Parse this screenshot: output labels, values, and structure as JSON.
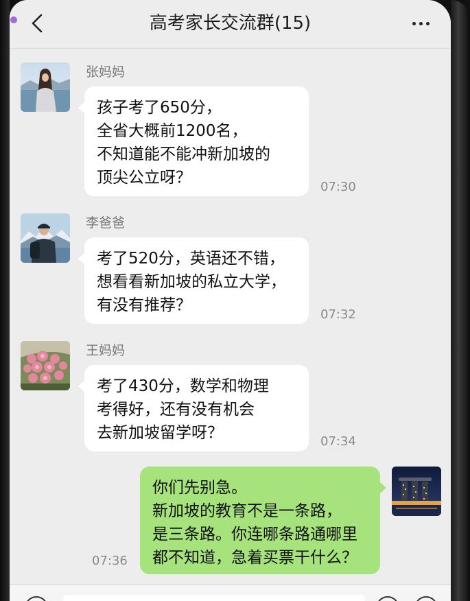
{
  "header": {
    "title": "高考家长交流群(15)",
    "back_icon": "chevron-left-icon",
    "more_icon": "more-horizontal-icon"
  },
  "messages": [
    {
      "sender": "张妈妈",
      "avatar": "woman-by-lake-avatar",
      "lines": [
        "孩子考了650分，",
        "全省大概前1200名，",
        "不知道能不能冲新加坡的",
        "顶尖公立呀？"
      ],
      "time": "07:30",
      "mine": false
    },
    {
      "sender": "李爸爸",
      "avatar": "man-mountain-avatar",
      "lines": [
        "考了520分，英语还不错，",
        "想看看新加坡的私立大学，",
        "有没有推荐？"
      ],
      "time": "07:32",
      "mine": false
    },
    {
      "sender": "王妈妈",
      "avatar": "pink-roses-avatar",
      "lines": [
        "考了430分，数学和物理",
        "考得好，还有没有机会",
        "去新加坡留学呀？"
      ],
      "time": "07:34",
      "mine": false
    },
    {
      "sender": "",
      "avatar": "singapore-night-skyline-avatar",
      "lines": [
        "你们先别急。",
        "新加坡的教育不是一条路，",
        "是三条路。你连哪条路通哪里",
        "都不知道，急着买票干什么？"
      ],
      "time": "07:36",
      "mine": true
    }
  ],
  "colors": {
    "background": "#ededed",
    "bubble_other": "#ffffff",
    "bubble_mine": "#a6e37c",
    "time_text": "#8a8a8a"
  }
}
